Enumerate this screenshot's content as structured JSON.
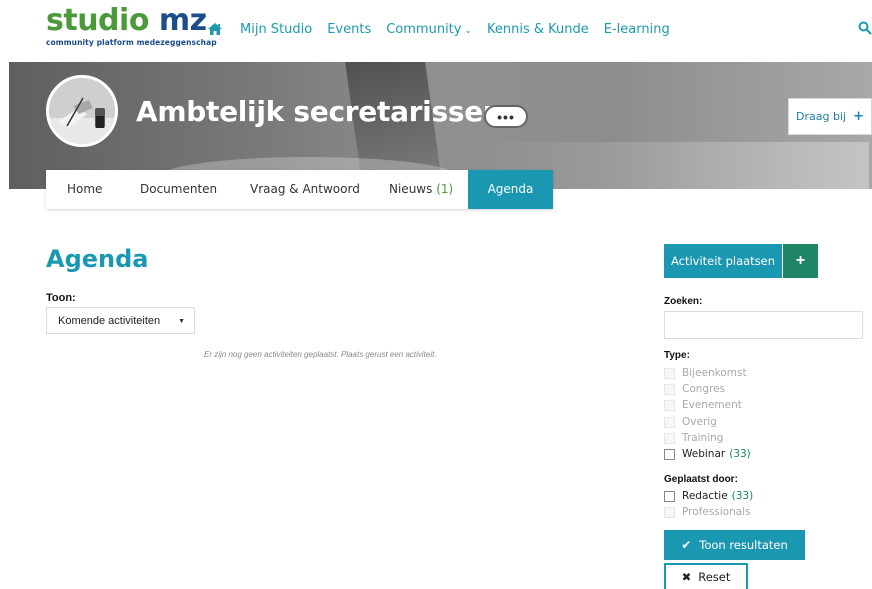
{
  "logo": {
    "part1": "studi",
    "part2": "o",
    "part3": " mz",
    "tagline": "community platform medezeggenschap"
  },
  "nav": {
    "items": [
      "Mijn Studio",
      "Events",
      "Community",
      "Kennis & Kunde",
      "E-learning"
    ],
    "dropdown_chevron": "⌄"
  },
  "hero": {
    "title": "Ambtelijk secretarissen",
    "more": "•••",
    "contribute_label": "Draag bij",
    "contribute_icon": "+"
  },
  "tabs": [
    {
      "label": "Home"
    },
    {
      "label": "Documenten"
    },
    {
      "label": "Vraag & Antwoord"
    },
    {
      "label": "Nieuws",
      "count": "(1)"
    },
    {
      "label": "Agenda",
      "active": true
    }
  ],
  "main": {
    "title": "Agenda",
    "show_label": "Toon:",
    "show_value": "Komende activiteiten",
    "empty_message": "Er zijn nog geen activiteiten geplaatst. Plaats gerust een activiteit."
  },
  "sidebar": {
    "post_button": "Activiteit plaatsen",
    "post_plus": "+",
    "search_label": "Zoeken:",
    "type_label": "Type:",
    "types": [
      {
        "label": "Bijeenkomst",
        "count": "",
        "enabled": false
      },
      {
        "label": "Congres",
        "count": "",
        "enabled": false
      },
      {
        "label": "Evenement",
        "count": "",
        "enabled": false
      },
      {
        "label": "Overig",
        "count": "",
        "enabled": false
      },
      {
        "label": "Training",
        "count": "",
        "enabled": false
      },
      {
        "label": "Webinar",
        "count": "(33)",
        "enabled": true
      }
    ],
    "posted_by_label": "Geplaatst door:",
    "posted_by": [
      {
        "label": "Redactie",
        "count": "(33)",
        "enabled": true
      },
      {
        "label": "Professionals",
        "count": "",
        "enabled": false
      }
    ],
    "apply_button": "Toon resultaten",
    "apply_icon": "✔",
    "reset_button": "Reset",
    "reset_icon": "✖"
  },
  "colors": {
    "accent": "#1b98b1",
    "green": "#1f8567",
    "logo_green": "#4a9a3a",
    "logo_blue": "#1a4d8a"
  },
  "icons": [
    "home-icon",
    "search-icon",
    "more-icon",
    "plus-icon",
    "check-icon",
    "close-icon"
  ]
}
